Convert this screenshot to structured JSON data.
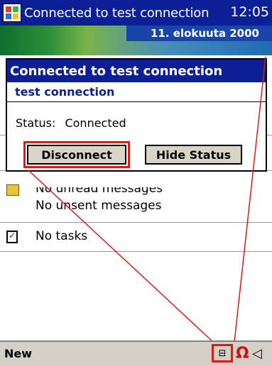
{
  "titlebar": {
    "title": "Connected to test connection",
    "time": "12:05",
    "start_icon": "windows-start-flag-icon"
  },
  "today": {
    "date": "11. elokuuta 2000",
    "messages_partial": "No unread messages",
    "unsent": "No unsent messages",
    "tasks": "No tasks"
  },
  "dialog": {
    "title": "Connected to test connection",
    "subtitle": "test connection",
    "status_label": "Status:",
    "status_value": "Connected",
    "disconnect_label": "Disconnect",
    "hide_status_label": "Hide Status"
  },
  "menubar": {
    "new_label": "New",
    "connection_icon": "network-connection-icon",
    "app_icon": "omega-app-icon",
    "speaker_icon": "speaker-icon"
  },
  "colors": {
    "title_bg": "#0c1f96",
    "highlight": "#e01818",
    "button_bg": "#d8d4c8"
  }
}
